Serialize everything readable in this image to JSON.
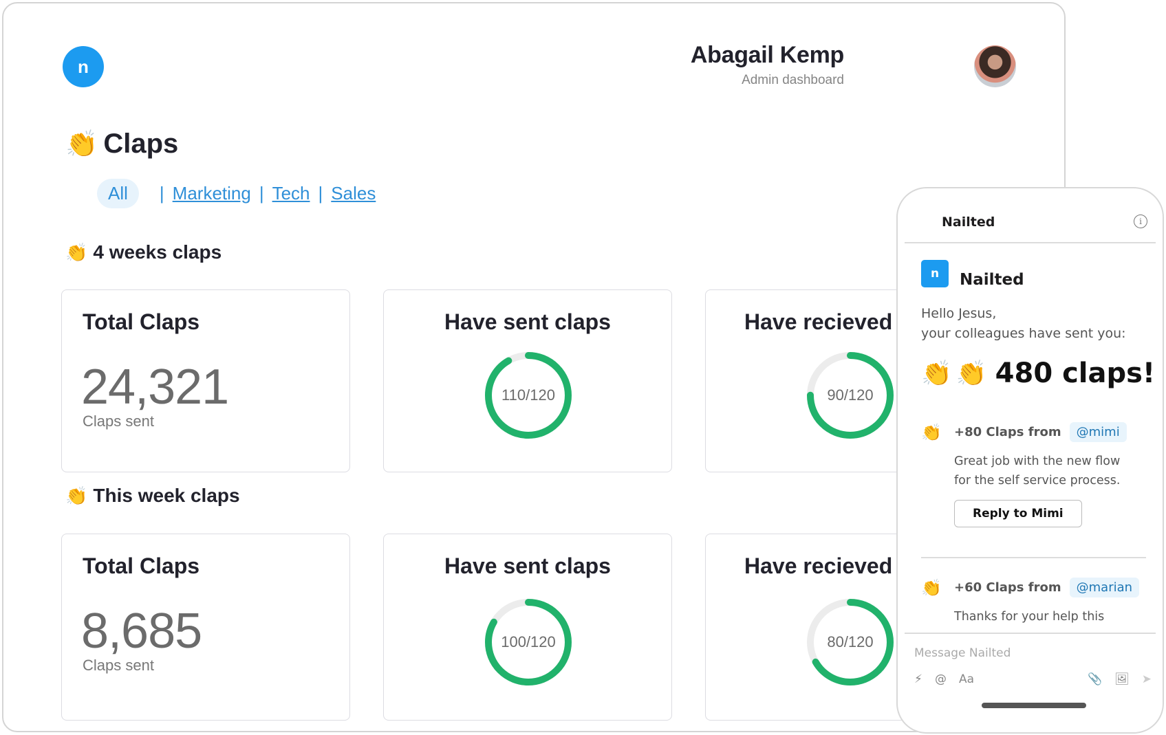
{
  "brand": {
    "logo_letter": "n",
    "accent": "#1c9bf0",
    "ring_color": "#21b26b",
    "ring_track": "#ececec"
  },
  "user": {
    "name": "Abagail Kemp",
    "role": "Admin dashboard"
  },
  "page": {
    "emoji": "👏",
    "title": "Claps"
  },
  "filters": {
    "active": "All",
    "links": [
      "Marketing",
      "Tech",
      "Sales"
    ],
    "separator": "|"
  },
  "sections": [
    {
      "emoji": "👏",
      "title": "4 weeks claps",
      "total": {
        "title": "Total Claps",
        "value": "24,321",
        "label": "Claps sent"
      },
      "sent": {
        "title": "Have sent claps",
        "value": 110,
        "max": 120,
        "label": "110/120"
      },
      "received": {
        "title": "Have recieved claps",
        "value": 90,
        "max": 120,
        "label": "90/120"
      }
    },
    {
      "emoji": "👏",
      "title": "This week claps",
      "total": {
        "title": "Total Claps",
        "value": "8,685",
        "label": "Claps sent"
      },
      "sent": {
        "title": "Have sent claps",
        "value": 100,
        "max": 120,
        "label": "100/120"
      },
      "received": {
        "title": "Have recieved claps",
        "value": 80,
        "max": 120,
        "label": "80/120"
      }
    }
  ],
  "phone": {
    "header_title": "Nailted",
    "info_icon": "i",
    "app_name": "Nailted",
    "greeting_line1": "Hello Jesus,",
    "greeting_line2": "your colleagues have sent you:",
    "claps_emoji": "👏",
    "claps_total": "480 claps!",
    "messages": [
      {
        "emoji": "👏",
        "from": "+80 Claps from",
        "mention": "@mimi",
        "body_line1": "Great job with the new flow",
        "body_line2": "for the  self service process.",
        "reply": "Reply to Mimi"
      },
      {
        "emoji": "👏",
        "from": "+60 Claps from",
        "mention": "@marian",
        "body_line1": "Thanks for your help this"
      }
    ],
    "composer_placeholder": "Message Nailted",
    "tools_left": [
      "⚡",
      "@",
      "Aa"
    ],
    "tools_right": [
      "📎",
      "🖼",
      "➤"
    ]
  }
}
